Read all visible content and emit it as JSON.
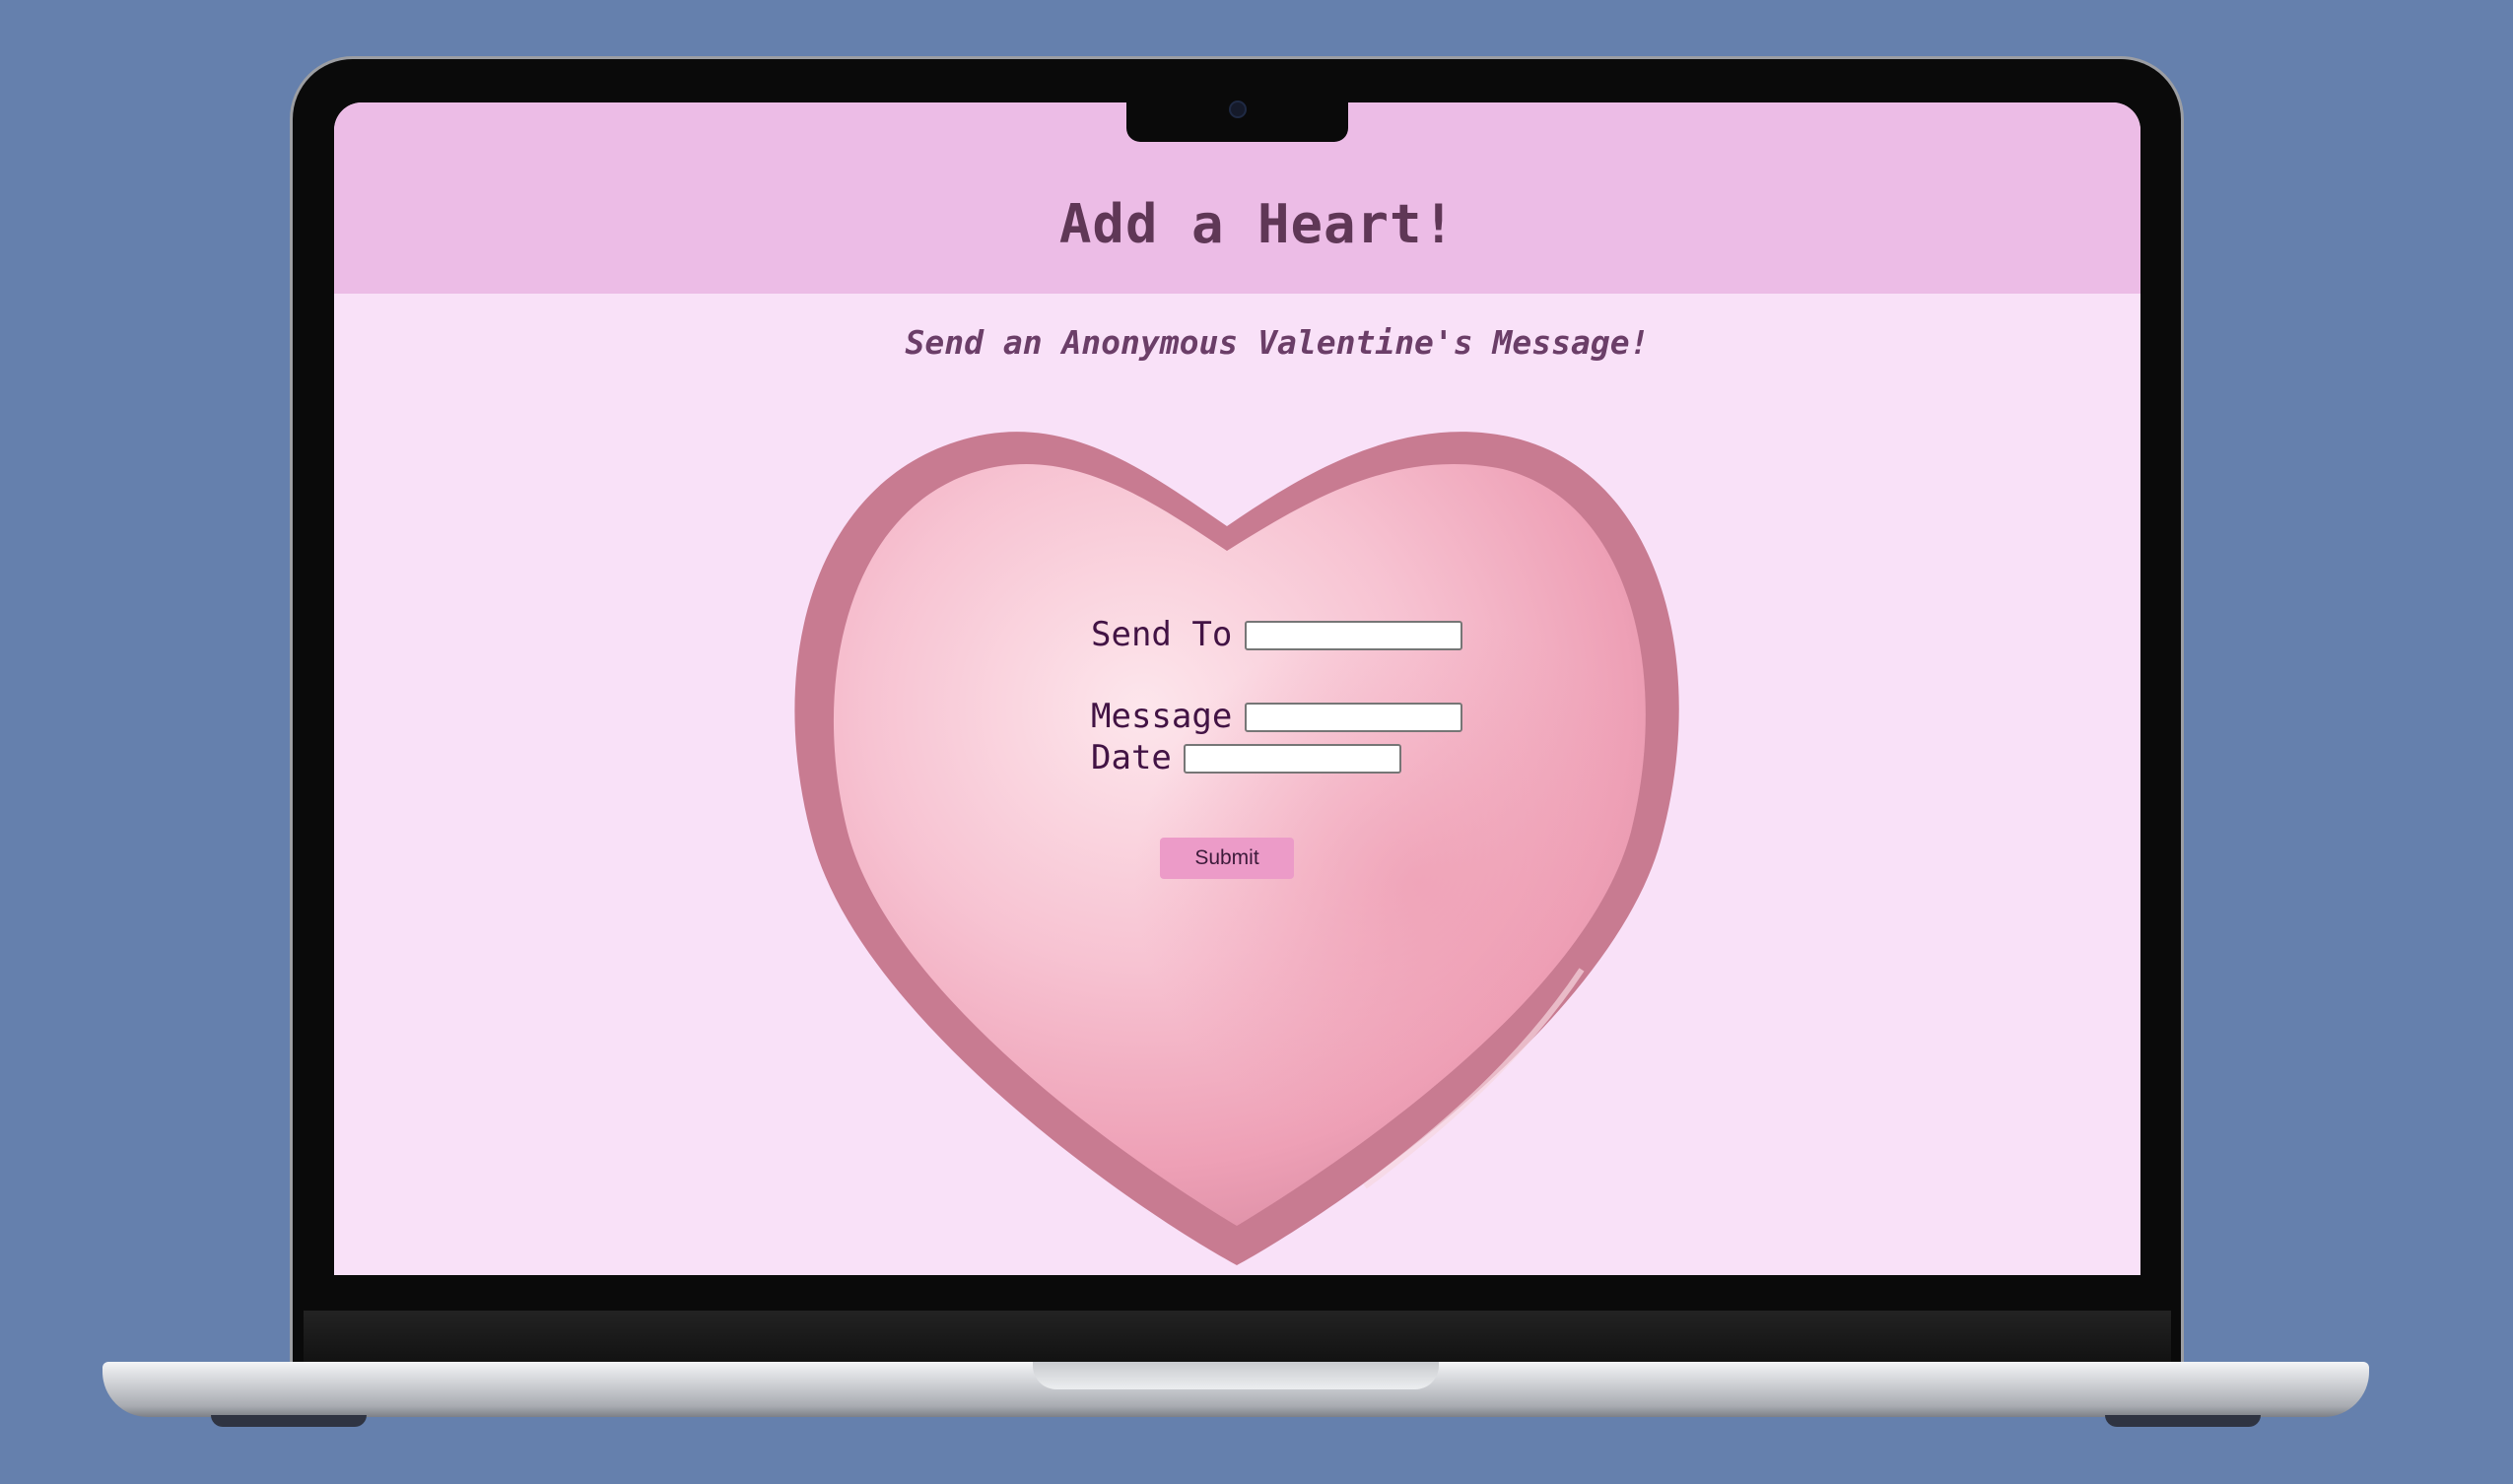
{
  "page": {
    "title": "Add a Heart!",
    "subtitle": "Send an Anonymous Valentine's Message!"
  },
  "form": {
    "send_to_label": "Send To",
    "send_to_value": "",
    "message_label": "Message",
    "message_value": "",
    "date_label": "Date",
    "date_value": "",
    "submit_label": "Submit"
  },
  "colors": {
    "background": "#6580ad",
    "header": "#ecbce6",
    "page": "#f9e1f8",
    "title_text": "#5f3756",
    "label_text": "#421344",
    "button": "#ec9bc8",
    "heart": "#f1a9bd"
  },
  "icons": [
    "heart-icon",
    "camera-icon"
  ]
}
